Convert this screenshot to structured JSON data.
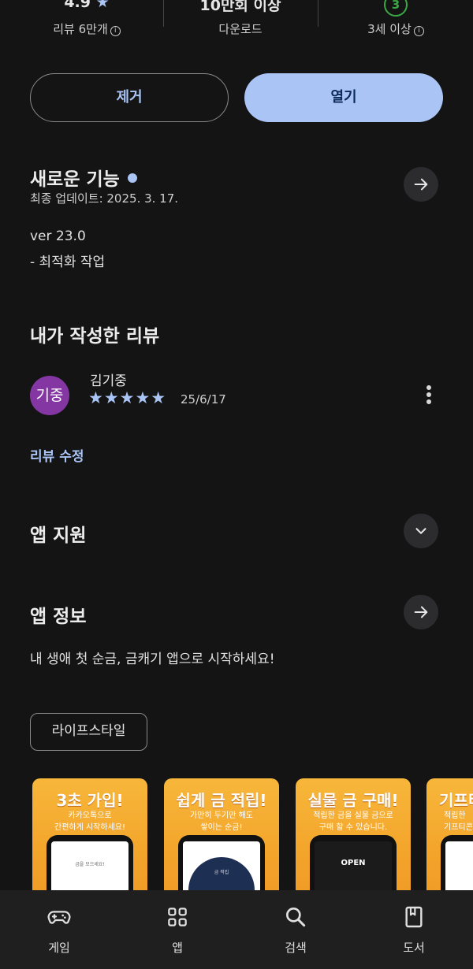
{
  "stats": {
    "rating": {
      "value": "4.9",
      "star": "★",
      "label": "리뷰 6만개"
    },
    "downloads": {
      "value": "10만회 이상",
      "label": "다운로드"
    },
    "age": {
      "badge": "3",
      "label": "3세 이상"
    }
  },
  "actions": {
    "remove_label": "제거",
    "open_label": "열기"
  },
  "whats_new": {
    "title": "새로운 기능",
    "updated": "최종 업데이트: 2025. 3. 17.",
    "version": "ver 23.0",
    "note": "- 최적화 작업"
  },
  "my_review": {
    "title": "내가 작성한 리뷰",
    "avatar_text": "기중",
    "avatar_color": "#8436a3",
    "reviewer": "김기중",
    "stars": "★★★★★",
    "rating": 5,
    "date": "25/6/17",
    "edit_label": "리뷰 수정"
  },
  "app_support": {
    "title": "앱 지원"
  },
  "app_info": {
    "title": "앱 정보",
    "description": "내 생애 첫 순금, 금캐기 앱으로 시작하세요!",
    "category": "라이프스타일"
  },
  "screenshots": [
    {
      "title": "3초 가입!",
      "line1": "카카오톡으로",
      "line2": "간편하게 시작하세요!",
      "inner": "금을 모으세요!"
    },
    {
      "title": "쉽게 금 적립!",
      "line1": "가만히 두기만 해도",
      "line2": "쌓이는 순금!",
      "inner": "금 적립"
    },
    {
      "title": "실물 금 구매!",
      "line1": "적립한 금을 실물 금으로",
      "line2": "구매 할 수 있습니다.",
      "inner": "OPEN"
    },
    {
      "title": "기프티",
      "line1": "적립한",
      "line2": "기프티콘",
      "inner": ""
    }
  ],
  "nav": {
    "items": [
      {
        "label": "게임",
        "icon": "gamepad-icon"
      },
      {
        "label": "앱",
        "icon": "apps-grid-icon"
      },
      {
        "label": "검색",
        "icon": "search-icon"
      },
      {
        "label": "도서",
        "icon": "book-icon"
      }
    ]
  },
  "colors": {
    "accent": "#aac4f5",
    "background": "#141414",
    "age_badge": "#3aa845"
  }
}
